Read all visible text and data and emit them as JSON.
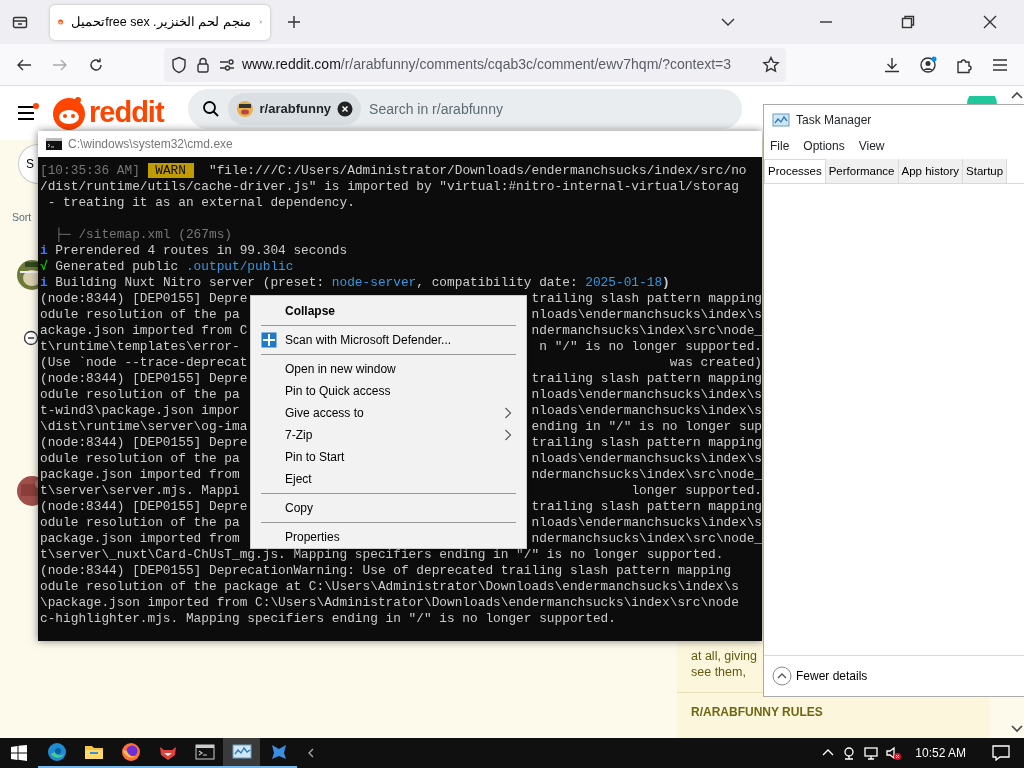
{
  "browser": {
    "tab": {
      "title": "منجم لحم الخنزير. free sexتحميل",
      "selected": true
    },
    "url": {
      "host": "www.reddit.com",
      "path": "/r/arabfunny/comments/cqab3c/comment/ewv7hqm/?context=3"
    }
  },
  "reddit": {
    "logo_text": "reddit",
    "search_chip": "r/arabfunny",
    "search_placeholder": "Search in r/arabfunny",
    "side_button": "S",
    "sort_label": "Sort",
    "sidebar_lines": [
      "at all, giving",
      "see them,"
    ],
    "rules_heading": "R/ARABFUNNY RULES"
  },
  "cmd": {
    "title": "C:\\windows\\system32\\cmd.exe",
    "lines": [
      {
        "kind": "full",
        "segments": [
          {
            "kind": "text",
            "text": "[10:35:36 AM]",
            "color": "#767676"
          },
          {
            "kind": "badge",
            "text": " WARN ",
            "color": "#c19c00"
          },
          {
            "kind": "text",
            "text": "  \"file:///C:/Users/Administrator/Downloads/endermanchsucks/index/src/no",
            "color": "#cccccc"
          }
        ]
      },
      {
        "kind": "full",
        "segments": [
          {
            "kind": "text",
            "text": "/dist/runtime/utils/cache-driver.js\" is imported by \"virtual:#nitro-internal-virtual/storag",
            "color": "#cccccc"
          }
        ]
      },
      {
        "kind": "full",
        "segments": [
          {
            "kind": "text",
            "text": " - treating it as an external dependency.",
            "color": "#cccccc"
          }
        ]
      },
      {
        "kind": "blank"
      },
      {
        "kind": "full",
        "segments": [
          {
            "kind": "text",
            "text": "  ├─ /sitemap.xml (267ms)",
            "color": "#767676"
          }
        ]
      },
      {
        "kind": "full",
        "segments": [
          {
            "kind": "text",
            "text": "i",
            "color": "#3b78ff"
          },
          {
            "kind": "text",
            "text": " Prerendered 4 routes in 99.304 seconds",
            "color": "#cccccc"
          }
        ]
      },
      {
        "kind": "full",
        "segments": [
          {
            "kind": "text",
            "text": "√",
            "color": "#16c60c"
          },
          {
            "kind": "text",
            "text": " Generated public ",
            "color": "#cccccc"
          },
          {
            "kind": "text",
            "text": ".output/public",
            "color": "#3a96dd"
          }
        ]
      },
      {
        "kind": "full",
        "segments": [
          {
            "kind": "text",
            "text": "i",
            "color": "#3b78ff"
          },
          {
            "kind": "text",
            "text": " Building Nuxt Nitro server (preset: ",
            "color": "#cccccc"
          },
          {
            "kind": "text",
            "text": "node-server",
            "color": "#3a96dd"
          },
          {
            "kind": "text",
            "text": ", compatibility date: ",
            "color": "#cccccc"
          },
          {
            "kind": "text",
            "text": "2025-01-18",
            "color": "#3a96dd"
          },
          {
            "kind": "text",
            "text": ")",
            "color": "#cccccc"
          }
        ]
      },
      {
        "kind": "split",
        "left": "(node:8344) [DEP0155] Depre",
        "right": "trailing slash pattern mapping"
      },
      {
        "kind": "split",
        "left": "odule resolution of the pa",
        "right": "nloads\\endermanchsucks\\index\\s"
      },
      {
        "kind": "split",
        "left": "ackage.json imported from C",
        "right": "ndermanchsucks\\index\\src\\node_"
      },
      {
        "kind": "split",
        "left": "t\\runtime\\templates\\error-",
        "right": "n \"/\" is no longer supported."
      },
      {
        "kind": "split",
        "left": "(Use `node --trace-deprecat",
        "right": " was created)"
      },
      {
        "kind": "split",
        "left": "(node:8344) [DEP0155] Depre",
        "right": "trailing slash pattern mapping"
      },
      {
        "kind": "split",
        "left": "odule resolution of the pa",
        "right": "nloads\\endermanchsucks\\index\\s"
      },
      {
        "kind": "split",
        "left": "t-wind3\\package.json impor",
        "right": "nloads\\endermanchsucks\\index\\s"
      },
      {
        "kind": "split",
        "left": "\\dist\\runtime\\server\\og-ima",
        "right": "ending in \"/\" is no longer sup"
      },
      {
        "kind": "split",
        "left": "(node:8344) [DEP0155] Depre",
        "right": "trailing slash pattern mapping"
      },
      {
        "kind": "split",
        "left": "odule resolution of the pa",
        "right": "nloads\\endermanchsucks\\index\\s"
      },
      {
        "kind": "split",
        "left": "package.json imported from",
        "right": "ndermanchsucks\\index\\src\\node_"
      },
      {
        "kind": "split",
        "left": "t\\server\\server.mjs. Mappi",
        "right": "longer supported."
      },
      {
        "kind": "split",
        "left": "(node:8344) [DEP0155] Depre",
        "right": "trailing slash pattern mapping"
      },
      {
        "kind": "split",
        "left": "odule resolution of the pa",
        "right": "nloads\\endermanchsucks\\index\\s"
      },
      {
        "kind": "split",
        "left": "package.json imported from",
        "right": "ndermanchsucks\\index\\src\\node_"
      },
      {
        "kind": "full",
        "segments": [
          {
            "kind": "text",
            "text": "t\\server\\_nuxt\\Card-ChUsT_mg.js. Mapping specifiers ending in \"/\" is no longer supported.",
            "color": "#cccccc"
          }
        ]
      },
      {
        "kind": "full",
        "segments": [
          {
            "kind": "text",
            "text": "(node:8344) [DEP0155] DeprecationWarning: Use of deprecated trailing slash pattern mapping",
            "color": "#cccccc"
          }
        ]
      },
      {
        "kind": "full",
        "segments": [
          {
            "kind": "text",
            "text": "odule resolution of the package at C:\\Users\\Administrator\\Downloads\\endermanchsucks\\index\\s",
            "color": "#cccccc"
          }
        ]
      },
      {
        "kind": "full",
        "segments": [
          {
            "kind": "text",
            "text": "\\package.json imported from C:\\Users\\Administrator\\Downloads\\endermanchsucks\\index\\src\\node",
            "color": "#cccccc"
          }
        ]
      },
      {
        "kind": "full",
        "segments": [
          {
            "kind": "text",
            "text": "c-highlighter.mjs. Mapping specifiers ending in \"/\" is no longer supported.",
            "color": "#cccccc"
          }
        ]
      }
    ]
  },
  "context_menu": {
    "items": [
      {
        "kind": "default",
        "label": "Collapse"
      },
      {
        "kind": "separator"
      },
      {
        "kind": "defender",
        "label": "Scan with Microsoft Defender..."
      },
      {
        "kind": "separator"
      },
      {
        "kind": "plain",
        "label": "Open in new window"
      },
      {
        "kind": "plain",
        "label": "Pin to Quick access"
      },
      {
        "kind": "submenu",
        "label": "Give access to"
      },
      {
        "kind": "submenu",
        "label": "7-Zip"
      },
      {
        "kind": "plain",
        "label": "Pin to Start"
      },
      {
        "kind": "plain",
        "label": "Eject"
      },
      {
        "kind": "separator"
      },
      {
        "kind": "plain",
        "label": "Copy"
      },
      {
        "kind": "separator"
      },
      {
        "kind": "plain",
        "label": "Properties"
      }
    ]
  },
  "task_manager": {
    "title": "Task Manager",
    "menu": [
      "File",
      "Options",
      "View"
    ],
    "tabs": [
      {
        "label": "Processes",
        "selected": true
      },
      {
        "label": "Performance",
        "selected": false
      },
      {
        "label": "App history",
        "selected": false
      },
      {
        "label": "Startup",
        "selected": false
      }
    ],
    "footer": "Fewer details"
  },
  "taskbar": {
    "apps": [
      {
        "kind": "edge",
        "selected": false
      },
      {
        "kind": "explorer",
        "selected": false
      },
      {
        "kind": "firefox",
        "selected": false
      },
      {
        "kind": "fox",
        "selected": false
      },
      {
        "kind": "cmd",
        "selected": false
      },
      {
        "kind": "taskmgr",
        "selected": true
      },
      {
        "kind": "tool",
        "selected": false
      }
    ],
    "clock": "10:52 AM"
  }
}
